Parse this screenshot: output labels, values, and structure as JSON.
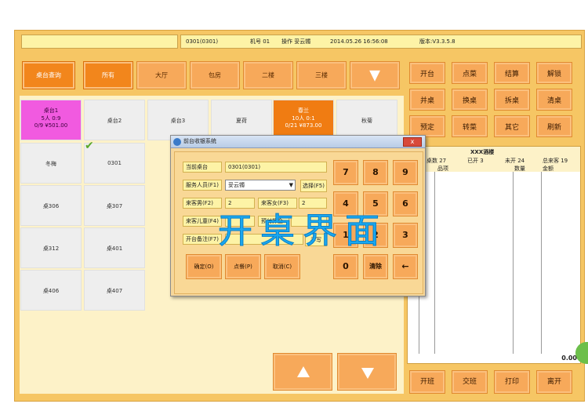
{
  "header": {
    "table_code": "0301(0301)",
    "machine": "机号 01",
    "operator": "操作 妥云镯",
    "datetime": "2014.05.26 16:56:08",
    "version": "版本:V3.3.5.8"
  },
  "left": {
    "query_label": "桌台查询",
    "filters": [
      "所有",
      "大厅",
      "包房",
      "二楼",
      "三楼"
    ],
    "filter_more": "▼"
  },
  "tables": [
    {
      "name": "桌台1",
      "line2": "5人 0:9",
      "line3": "0/9 ¥501.00"
    },
    {
      "name": "桌台2"
    },
    {
      "name": "桌台3"
    },
    {
      "name": "夏荷"
    },
    {
      "name": "春兰",
      "line2": "10人 0:1",
      "line3": "0/21 ¥873.00"
    },
    {
      "name": "秋菊"
    },
    {
      "name": "冬梅"
    },
    {
      "name": "0301"
    },
    {
      "name": "桌306"
    },
    {
      "name": "桌307"
    },
    {
      "name": "桌312"
    },
    {
      "name": "桌401"
    },
    {
      "name": "桌406"
    },
    {
      "name": "桌407"
    }
  ],
  "actions": [
    "开台",
    "点菜",
    "结算",
    "解锁",
    "并桌",
    "换桌",
    "拆桌",
    "清桌",
    "预定",
    "转菜",
    "其它",
    "刷新"
  ],
  "order": {
    "restaurant": "XXX酒楼",
    "stat_total": "桌数 27",
    "stat_open": "已开 3",
    "stat_unopen": "未开 24",
    "stat_guests": "总来客 19",
    "col_item": "品项",
    "col_qty": "数量",
    "col_amount": "金额",
    "total": "0.00"
  },
  "dialog": {
    "title": "前台收银系统",
    "close": "x",
    "field_table_label": "当前桌台",
    "field_table_value": "0301(0301)",
    "field_staff_label": "服务人员(F1)",
    "field_staff_value": "妥云镯",
    "select_button": "选择(F5)",
    "male_label": "来客男(F2)",
    "male_value": "2",
    "female_label": "来客女(F3)",
    "female_value": "2",
    "child_label": "来客儿童(F4)",
    "prepay_label": "预付押金",
    "note_label": "开台备注(F7)",
    "handwrite": "手写",
    "confirm": "确定(O)",
    "order_dish": "点餐(P)",
    "cancel": "取消(C)",
    "keys": [
      "7",
      "8",
      "9",
      "4",
      "5",
      "6",
      "1",
      "2",
      "3",
      "0",
      "清除",
      "←"
    ]
  },
  "watermark": "开桌界面",
  "bottom": [
    "开班",
    "交班",
    "打印",
    "离开"
  ]
}
